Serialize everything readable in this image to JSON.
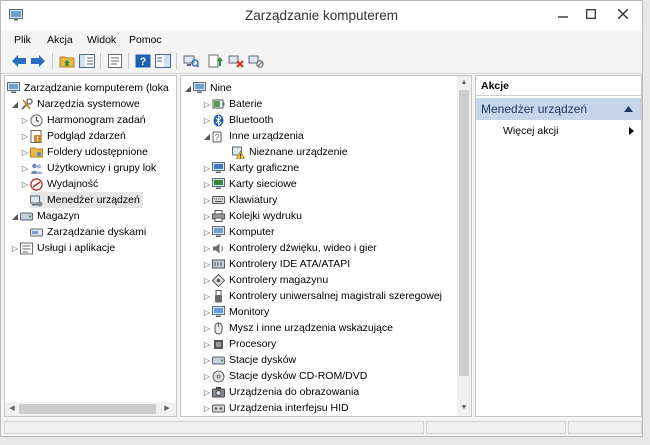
{
  "window": {
    "title": "Zarządzanie komputerem"
  },
  "menu": [
    "Plik",
    "Akcja",
    "Widok",
    "Pomoc"
  ],
  "tree": {
    "root": "Zarządzanie komputerem (loka",
    "items": [
      "Narzędzia systemowe",
      "Harmonogram zadań",
      "Podgląd zdarzeń",
      "Foldery udostępnione",
      "Użytkownicy i grupy lok",
      "Wydajność",
      "Menedżer urządzeń",
      "Magazyn",
      "Zarządzanie dyskami",
      "Usługi i aplikacje"
    ]
  },
  "devices": {
    "root": "Nine",
    "items": [
      "Baterie",
      "Bluetooth",
      "Inne urządzenia",
      "Nieznane urządzenie",
      "Karty graficzne",
      "Karty sieciowe",
      "Klawiatury",
      "Kolejki wydruku",
      "Komputer",
      "Kontrolery dźwięku, wideo i gier",
      "Kontrolery IDE ATA/ATAPI",
      "Kontrolery magazynu",
      "Kontrolery uniwersalnej magistrali szeregowej",
      "Monitory",
      "Mysz i inne urządzenia wskazujące",
      "Procesory",
      "Stacje dysków",
      "Stacje dysków CD-ROM/DVD",
      "Urządzenia do obrazowania",
      "Urządzenia interfejsu HID"
    ]
  },
  "actions": {
    "header": "Akcje",
    "section": "Menedżer urządzeń",
    "more": "Więcej akcji"
  },
  "colors": {
    "selection": "#e6e6e6",
    "actions_section": "#c5d6ea",
    "toolbar_blue": "#1f5fb4",
    "folder": "#e8b84a"
  }
}
